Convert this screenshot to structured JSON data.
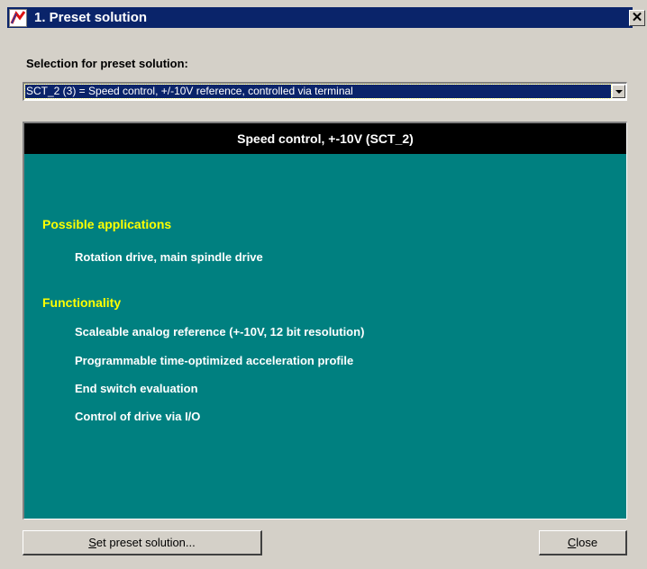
{
  "window": {
    "title": "1. Preset solution",
    "close_glyph": "✕"
  },
  "selection": {
    "label": "Selection for preset solution:",
    "selected_value": "SCT_2 (3) = Speed control, +/-10V reference, controlled via terminal"
  },
  "panel": {
    "header": "Speed control, +-10V (SCT_2)",
    "applications_heading": "Possible applications",
    "applications": [
      "Rotation drive, main spindle drive"
    ],
    "functionality_heading": "Functionality",
    "functionality": [
      "Scaleable analog reference (+-10V, 12 bit resolution)",
      "Programmable time-optimized acceleration profile",
      "End switch evaluation",
      "Control of drive via I/O"
    ],
    "colors": {
      "background": "#008080",
      "header_background": "#000000",
      "heading_text": "#ffff00",
      "item_text": "#ffffff"
    }
  },
  "buttons": {
    "set_preset_first": "S",
    "set_preset_rest": "et preset solution...",
    "close_first": "C",
    "close_rest": "lose"
  },
  "icons": {
    "app": "app-logo-icon",
    "dropdown": "chevron-down-icon",
    "close": "close-icon"
  }
}
